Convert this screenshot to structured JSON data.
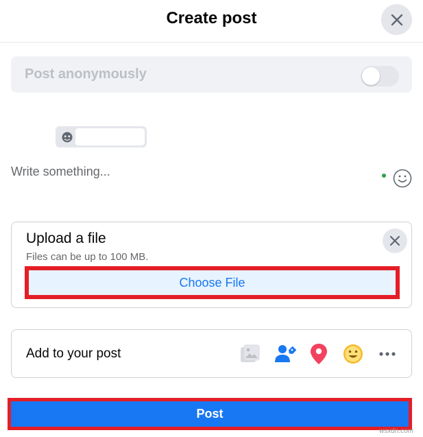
{
  "header": {
    "title": "Create post",
    "close_icon": "close-icon"
  },
  "anonymous": {
    "label": "Post anonymously",
    "enabled": false
  },
  "audience": {
    "icon": "privacy-icon",
    "value": ""
  },
  "composer": {
    "placeholder": "Write something...",
    "emoji_icon": "smiley-icon"
  },
  "upload": {
    "title": "Upload a file",
    "subtitle": "Files can be up to 100 MB.",
    "button_label": "Choose File",
    "close_icon": "close-icon"
  },
  "add_to_post": {
    "label": "Add to your post",
    "icons": [
      "photo-icon",
      "tag-people-icon",
      "location-icon",
      "feeling-icon",
      "more-icon"
    ]
  },
  "post_button": {
    "label": "Post"
  },
  "watermark": "wsxdn.com",
  "colors": {
    "brand_blue": "#1877f2",
    "highlight_red": "#e41e26",
    "location_red": "#f3425f",
    "feeling_yellow": "#f7b928",
    "status_green": "#31a24c"
  }
}
